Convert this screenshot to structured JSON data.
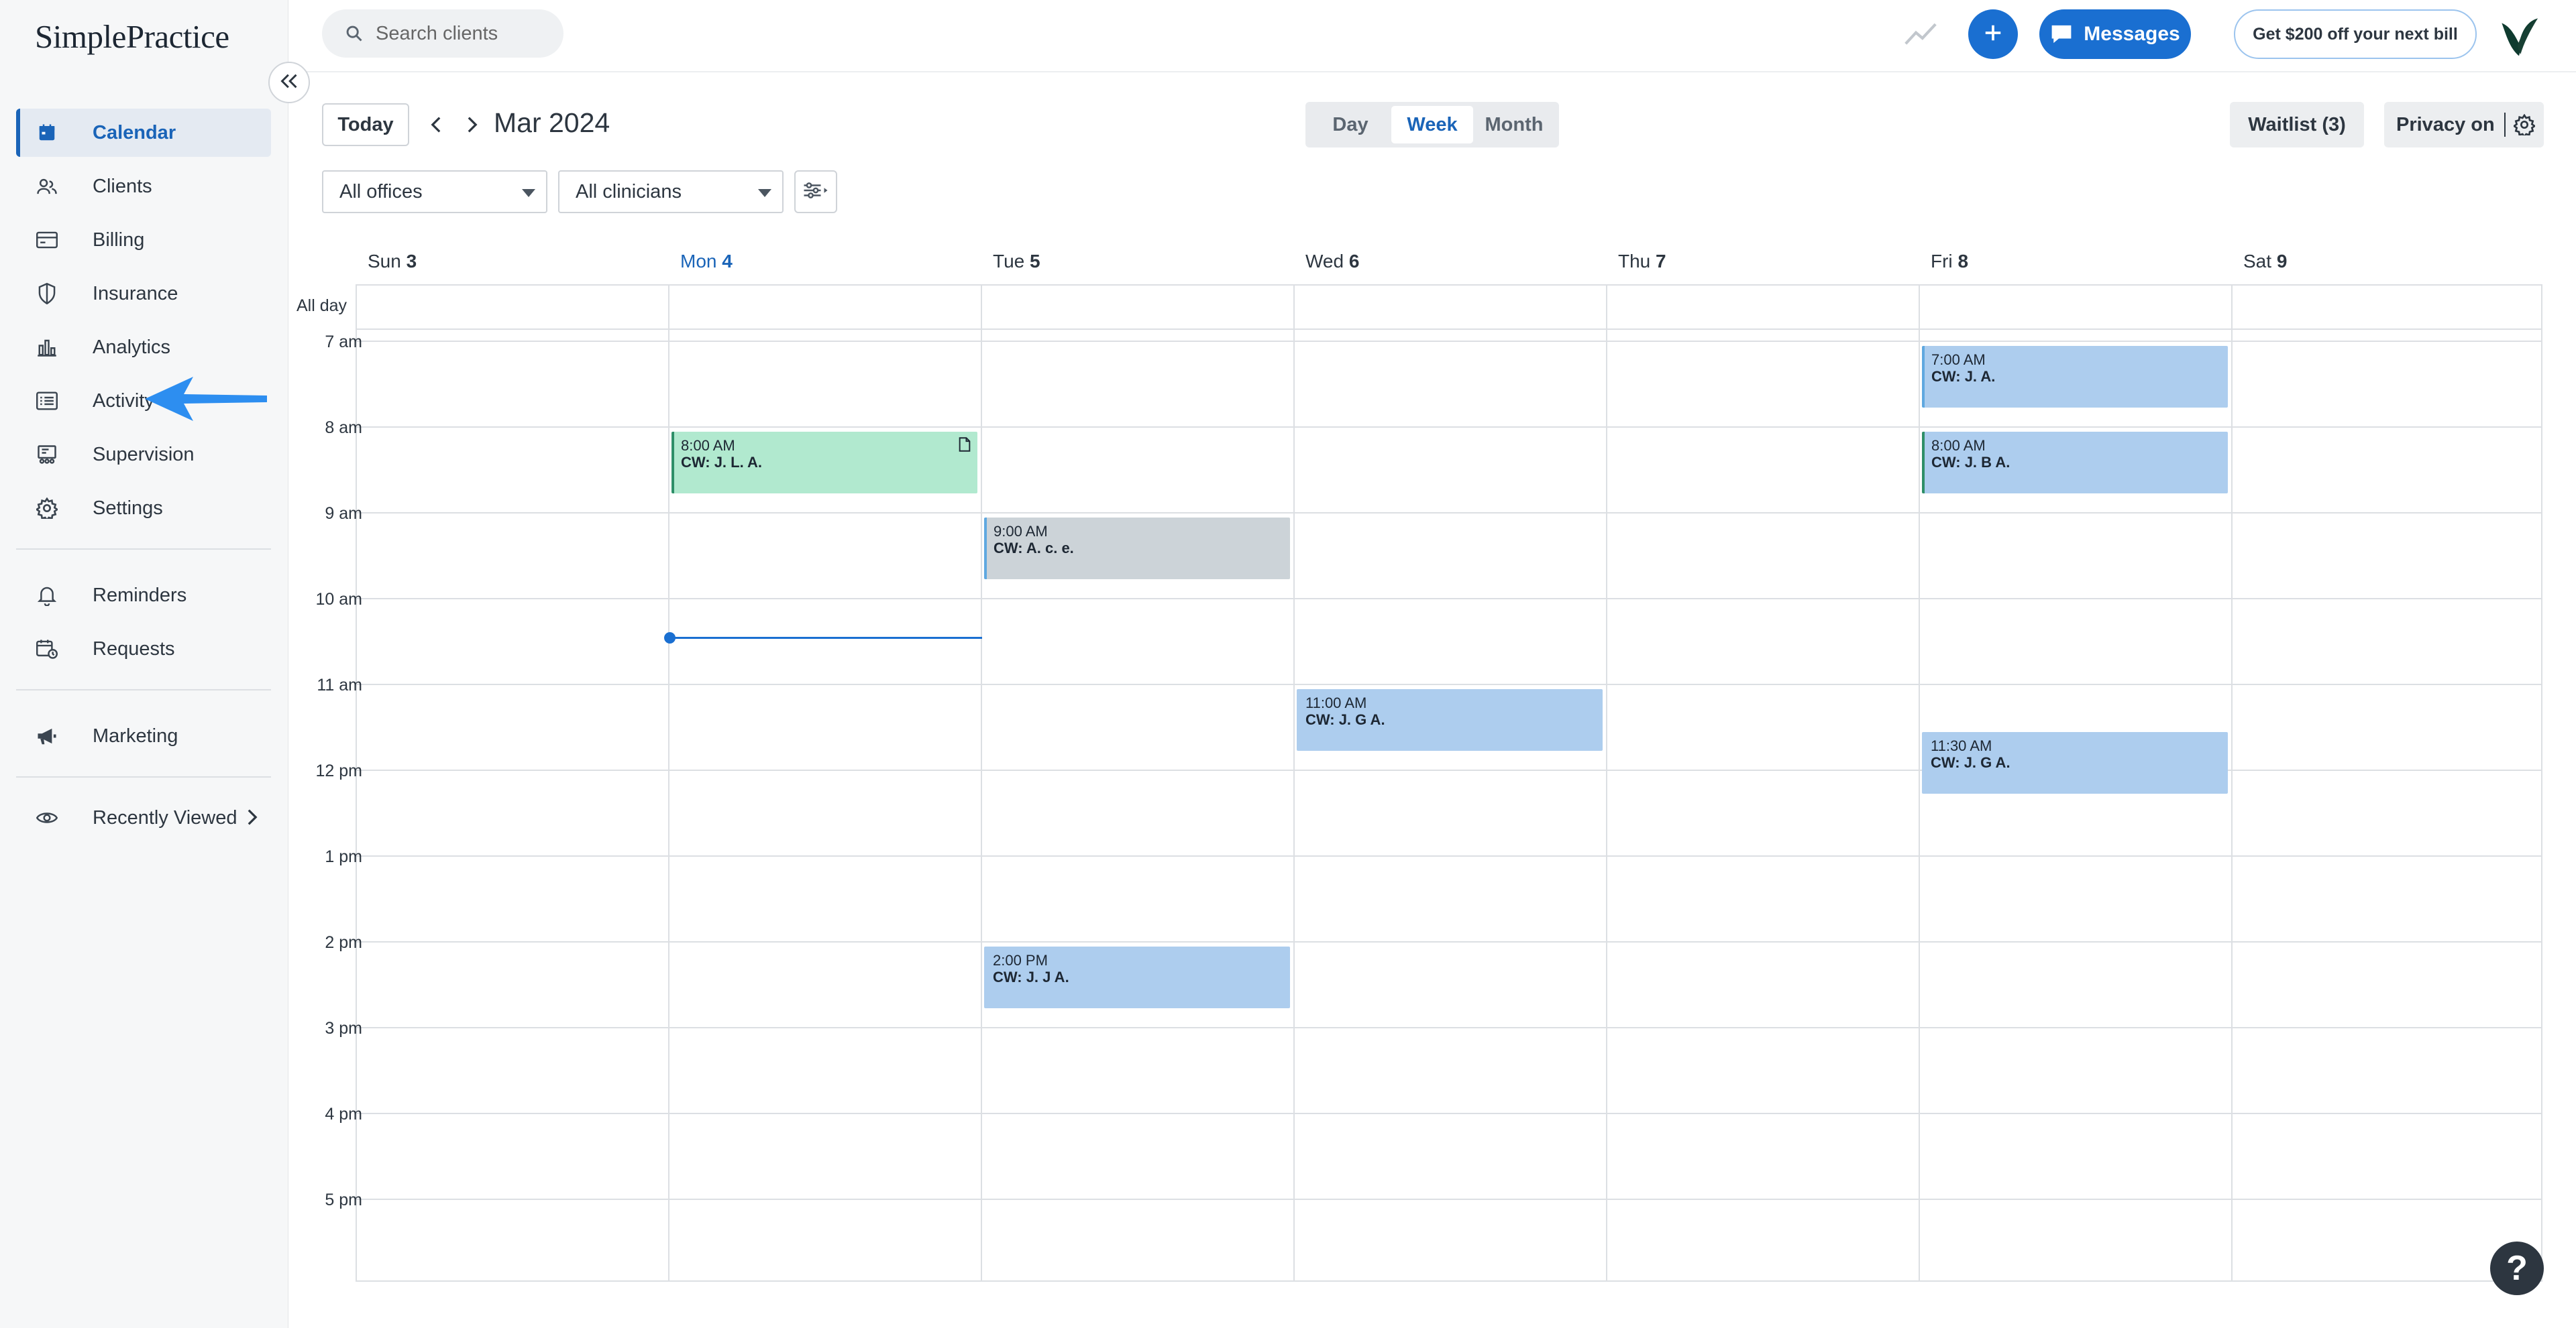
{
  "app": {
    "logo": "SimplePractice"
  },
  "sidebar": {
    "items": [
      {
        "label": "Calendar",
        "icon": "calendar-icon",
        "active": true
      },
      {
        "label": "Clients",
        "icon": "clients-icon"
      },
      {
        "label": "Billing",
        "icon": "billing-card-icon"
      },
      {
        "label": "Insurance",
        "icon": "shield-icon"
      },
      {
        "label": "Analytics",
        "icon": "bar-chart-icon"
      },
      {
        "label": "Activity",
        "icon": "activity-list-icon"
      },
      {
        "label": "Supervision",
        "icon": "supervision-icon"
      },
      {
        "label": "Settings",
        "icon": "gear-icon"
      },
      {
        "label": "Reminders",
        "icon": "bell-icon"
      },
      {
        "label": "Requests",
        "icon": "calendar-request-icon"
      },
      {
        "label": "Marketing",
        "icon": "megaphone-icon"
      },
      {
        "label": "Recently Viewed",
        "icon": "eye-icon"
      }
    ]
  },
  "topbar": {
    "search_placeholder": "Search clients",
    "messages_label": "Messages",
    "promo_label": "Get $200 off your next bill"
  },
  "toolbar": {
    "today_label": "Today",
    "month_title": "Mar 2024",
    "views": [
      "Day",
      "Week",
      "Month"
    ],
    "active_view": "Week",
    "waitlist_label": "Waitlist (3)",
    "privacy_label": "Privacy on",
    "offices_value": "All offices",
    "clinicians_value": "All clinicians"
  },
  "calendar": {
    "allday_label": "All day",
    "days": [
      {
        "name": "Sun",
        "num": "3"
      },
      {
        "name": "Mon",
        "num": "4",
        "today": true
      },
      {
        "name": "Tue",
        "num": "5"
      },
      {
        "name": "Wed",
        "num": "6"
      },
      {
        "name": "Thu",
        "num": "7"
      },
      {
        "name": "Fri",
        "num": "8"
      },
      {
        "name": "Sat",
        "num": "9"
      }
    ],
    "hours": [
      "7 am",
      "8 am",
      "9 am",
      "10 am",
      "11 am",
      "12 pm",
      "1 pm",
      "2 pm",
      "3 pm",
      "4 pm",
      "5 pm"
    ],
    "events": [
      {
        "day": "Mon",
        "time": "8:00 AM",
        "name": "CW: J. L. A.",
        "color": "green"
      },
      {
        "day": "Tue",
        "time": "9:00 AM",
        "name": "CW: A. c. e.",
        "color": "gray"
      },
      {
        "day": "Tue",
        "time": "2:00 PM",
        "name": "CW: J. J A.",
        "color": "blue"
      },
      {
        "day": "Wed",
        "time": "11:00 AM",
        "name": "CW: J. G A.",
        "color": "blue"
      },
      {
        "day": "Fri",
        "time": "7:00 AM",
        "name": "CW: J. A.",
        "color": "blue"
      },
      {
        "day": "Fri",
        "time": "8:00 AM",
        "name": "CW: J. B A.",
        "color": "blue"
      },
      {
        "day": "Fri",
        "time": "11:30 AM",
        "name": "CW: J. G A.",
        "color": "blue"
      }
    ]
  },
  "colors": {
    "accent": "#1a6fd1",
    "event_blue": "#adcdee",
    "event_green": "#b1e9cf",
    "event_gray": "#ccd3d8"
  },
  "help_label": "?"
}
